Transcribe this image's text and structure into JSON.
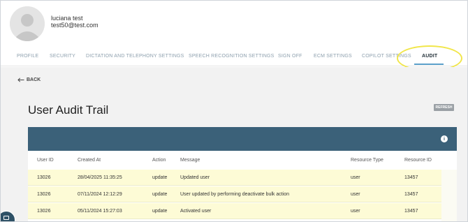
{
  "user": {
    "name": "luciana test",
    "email": "test50@test.com",
    "avatar_icon": "user-avatar-icon"
  },
  "tabs": [
    {
      "label": "PROFILE"
    },
    {
      "label": "SECURITY"
    },
    {
      "label": "DICTATION AND TELEPHONY SETTINGS"
    },
    {
      "label": "SPEECH RECOGNITION SETTINGS"
    },
    {
      "label": "SIGN OFF"
    },
    {
      "label": "ECM SETTINGS"
    },
    {
      "label": "COPILOT SETTINGS"
    },
    {
      "label": "AUDIT",
      "active": true
    }
  ],
  "back_label": "BACK",
  "page_title": "User Audit Trail",
  "refresh_label": "REFRESH",
  "colors": {
    "table_header_bar": "#3b6179",
    "row_highlight": "#fdfbd6",
    "annotation": "#f1e64a",
    "active_tab_underline": "#5a9fc9"
  },
  "table": {
    "columns": [
      "User ID",
      "Created At",
      "Action",
      "Message",
      "Resource Type",
      "Resource ID"
    ],
    "rows": [
      [
        "13026",
        "28/04/2025 11:35:25",
        "update",
        "Updated user",
        "user",
        "13457"
      ],
      [
        "13026",
        "07/11/2024 12:12:29",
        "update",
        "User updated by performing deactivate bulk action",
        "user",
        "13457"
      ],
      [
        "13026",
        "05/11/2024 15:27:03",
        "update",
        "Activated user",
        "user",
        "13457"
      ]
    ]
  }
}
